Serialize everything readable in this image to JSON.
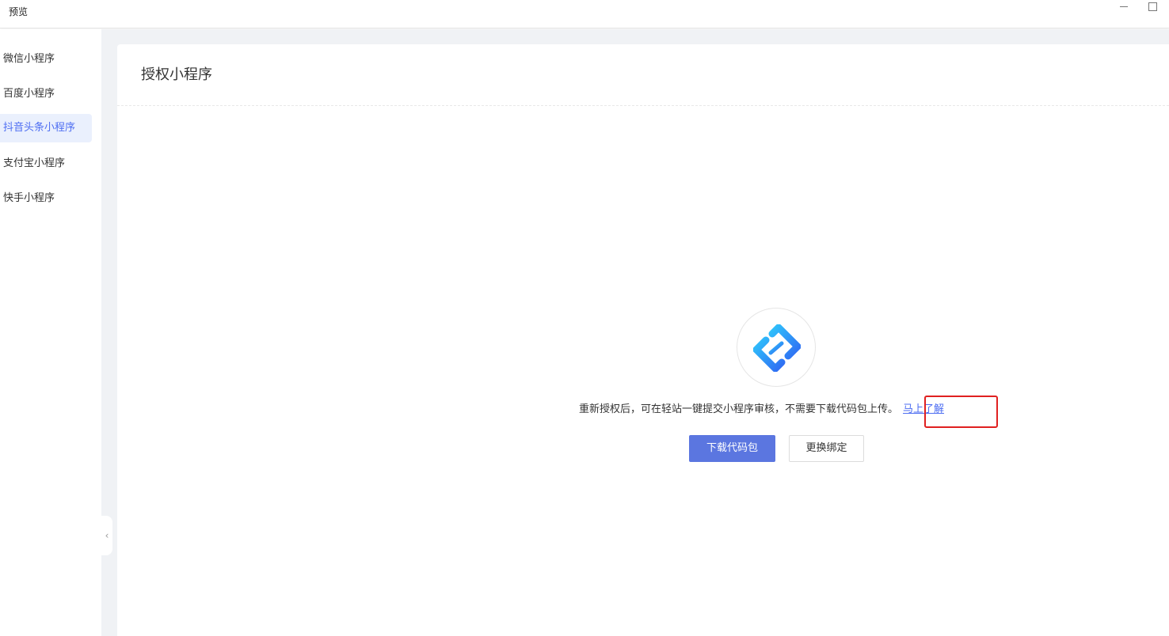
{
  "window": {
    "title": "预览"
  },
  "sidebar": {
    "items": [
      {
        "label": "微信小程序",
        "active": false
      },
      {
        "label": "百度小程序",
        "active": false
      },
      {
        "label": "抖音头条小程序",
        "active": true
      },
      {
        "label": "支付宝小程序",
        "active": false
      },
      {
        "label": "快手小程序",
        "active": false
      }
    ],
    "collapse_icon": "‹"
  },
  "panel": {
    "title": "授权小程序",
    "logo_icon": "link-logo-icon",
    "description": "重新授权后，可在轻站一键提交小程序审核，不需要下载代码包上传。",
    "learn_more": "马上了解",
    "download_button": "下载代码包",
    "rebind_button": "更换绑定"
  },
  "colors": {
    "accent": "#4e6ef2",
    "primary_button": "#5b76e0",
    "logo_gradient_start": "#2fc1fb",
    "logo_gradient_end": "#2f6cf3",
    "highlight_box": "#e02020"
  }
}
